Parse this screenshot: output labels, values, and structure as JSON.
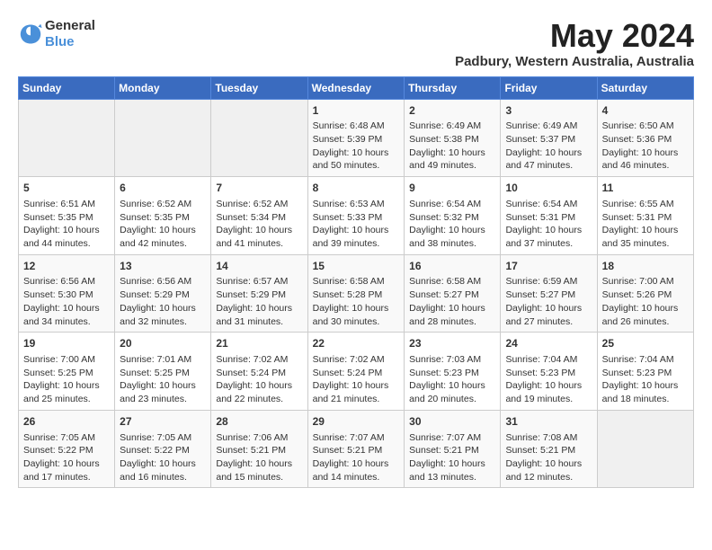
{
  "header": {
    "logo_line1": "General",
    "logo_line2": "Blue",
    "month_year": "May 2024",
    "location": "Padbury, Western Australia, Australia"
  },
  "days_of_week": [
    "Sunday",
    "Monday",
    "Tuesday",
    "Wednesday",
    "Thursday",
    "Friday",
    "Saturday"
  ],
  "weeks": [
    [
      {
        "day": "",
        "info": ""
      },
      {
        "day": "",
        "info": ""
      },
      {
        "day": "",
        "info": ""
      },
      {
        "day": "1",
        "info": "Sunrise: 6:48 AM\nSunset: 5:39 PM\nDaylight: 10 hours\nand 50 minutes."
      },
      {
        "day": "2",
        "info": "Sunrise: 6:49 AM\nSunset: 5:38 PM\nDaylight: 10 hours\nand 49 minutes."
      },
      {
        "day": "3",
        "info": "Sunrise: 6:49 AM\nSunset: 5:37 PM\nDaylight: 10 hours\nand 47 minutes."
      },
      {
        "day": "4",
        "info": "Sunrise: 6:50 AM\nSunset: 5:36 PM\nDaylight: 10 hours\nand 46 minutes."
      }
    ],
    [
      {
        "day": "5",
        "info": "Sunrise: 6:51 AM\nSunset: 5:35 PM\nDaylight: 10 hours\nand 44 minutes."
      },
      {
        "day": "6",
        "info": "Sunrise: 6:52 AM\nSunset: 5:35 PM\nDaylight: 10 hours\nand 42 minutes."
      },
      {
        "day": "7",
        "info": "Sunrise: 6:52 AM\nSunset: 5:34 PM\nDaylight: 10 hours\nand 41 minutes."
      },
      {
        "day": "8",
        "info": "Sunrise: 6:53 AM\nSunset: 5:33 PM\nDaylight: 10 hours\nand 39 minutes."
      },
      {
        "day": "9",
        "info": "Sunrise: 6:54 AM\nSunset: 5:32 PM\nDaylight: 10 hours\nand 38 minutes."
      },
      {
        "day": "10",
        "info": "Sunrise: 6:54 AM\nSunset: 5:31 PM\nDaylight: 10 hours\nand 37 minutes."
      },
      {
        "day": "11",
        "info": "Sunrise: 6:55 AM\nSunset: 5:31 PM\nDaylight: 10 hours\nand 35 minutes."
      }
    ],
    [
      {
        "day": "12",
        "info": "Sunrise: 6:56 AM\nSunset: 5:30 PM\nDaylight: 10 hours\nand 34 minutes."
      },
      {
        "day": "13",
        "info": "Sunrise: 6:56 AM\nSunset: 5:29 PM\nDaylight: 10 hours\nand 32 minutes."
      },
      {
        "day": "14",
        "info": "Sunrise: 6:57 AM\nSunset: 5:29 PM\nDaylight: 10 hours\nand 31 minutes."
      },
      {
        "day": "15",
        "info": "Sunrise: 6:58 AM\nSunset: 5:28 PM\nDaylight: 10 hours\nand 30 minutes."
      },
      {
        "day": "16",
        "info": "Sunrise: 6:58 AM\nSunset: 5:27 PM\nDaylight: 10 hours\nand 28 minutes."
      },
      {
        "day": "17",
        "info": "Sunrise: 6:59 AM\nSunset: 5:27 PM\nDaylight: 10 hours\nand 27 minutes."
      },
      {
        "day": "18",
        "info": "Sunrise: 7:00 AM\nSunset: 5:26 PM\nDaylight: 10 hours\nand 26 minutes."
      }
    ],
    [
      {
        "day": "19",
        "info": "Sunrise: 7:00 AM\nSunset: 5:25 PM\nDaylight: 10 hours\nand 25 minutes."
      },
      {
        "day": "20",
        "info": "Sunrise: 7:01 AM\nSunset: 5:25 PM\nDaylight: 10 hours\nand 23 minutes."
      },
      {
        "day": "21",
        "info": "Sunrise: 7:02 AM\nSunset: 5:24 PM\nDaylight: 10 hours\nand 22 minutes."
      },
      {
        "day": "22",
        "info": "Sunrise: 7:02 AM\nSunset: 5:24 PM\nDaylight: 10 hours\nand 21 minutes."
      },
      {
        "day": "23",
        "info": "Sunrise: 7:03 AM\nSunset: 5:23 PM\nDaylight: 10 hours\nand 20 minutes."
      },
      {
        "day": "24",
        "info": "Sunrise: 7:04 AM\nSunset: 5:23 PM\nDaylight: 10 hours\nand 19 minutes."
      },
      {
        "day": "25",
        "info": "Sunrise: 7:04 AM\nSunset: 5:23 PM\nDaylight: 10 hours\nand 18 minutes."
      }
    ],
    [
      {
        "day": "26",
        "info": "Sunrise: 7:05 AM\nSunset: 5:22 PM\nDaylight: 10 hours\nand 17 minutes."
      },
      {
        "day": "27",
        "info": "Sunrise: 7:05 AM\nSunset: 5:22 PM\nDaylight: 10 hours\nand 16 minutes."
      },
      {
        "day": "28",
        "info": "Sunrise: 7:06 AM\nSunset: 5:21 PM\nDaylight: 10 hours\nand 15 minutes."
      },
      {
        "day": "29",
        "info": "Sunrise: 7:07 AM\nSunset: 5:21 PM\nDaylight: 10 hours\nand 14 minutes."
      },
      {
        "day": "30",
        "info": "Sunrise: 7:07 AM\nSunset: 5:21 PM\nDaylight: 10 hours\nand 13 minutes."
      },
      {
        "day": "31",
        "info": "Sunrise: 7:08 AM\nSunset: 5:21 PM\nDaylight: 10 hours\nand 12 minutes."
      },
      {
        "day": "",
        "info": ""
      }
    ]
  ]
}
